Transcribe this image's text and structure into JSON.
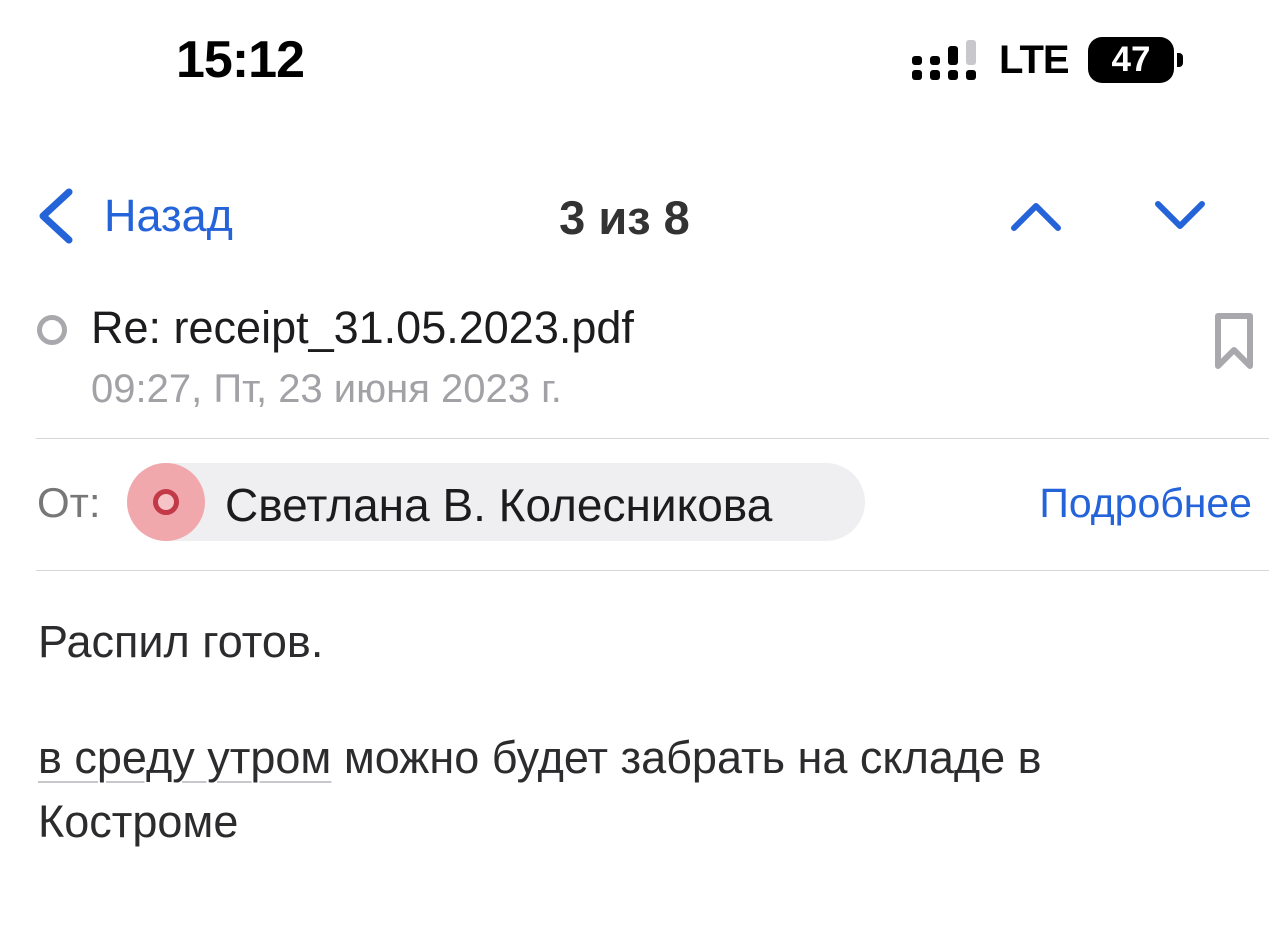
{
  "status_bar": {
    "time": "15:12",
    "network": "LTE",
    "battery": "47"
  },
  "nav": {
    "back_label": "Назад",
    "counter": "3 из 8"
  },
  "message": {
    "subject": "Re: receipt_31.05.2023.pdf",
    "date": "09:27, Пт, 23 июня 2023 г.",
    "from_label": "От:",
    "sender_name": "Светлана В. Колесникова",
    "details_label": "Подробнее",
    "body": {
      "line1": "Распил готов.",
      "link_text": "в среду утром",
      "rest_text": " можно будет забрать на складе в Костроме"
    }
  },
  "colors": {
    "accent": "#2563d9",
    "secondary_text": "#a1a1a6",
    "avatar_bg": "#f1a8ac",
    "avatar_ring": "#c23a48"
  },
  "icons": {
    "back": "chevron-left-icon",
    "prev": "chevron-up-icon",
    "next": "chevron-down-icon",
    "bookmark": "bookmark-icon",
    "read_status": "unread-dot-icon"
  }
}
